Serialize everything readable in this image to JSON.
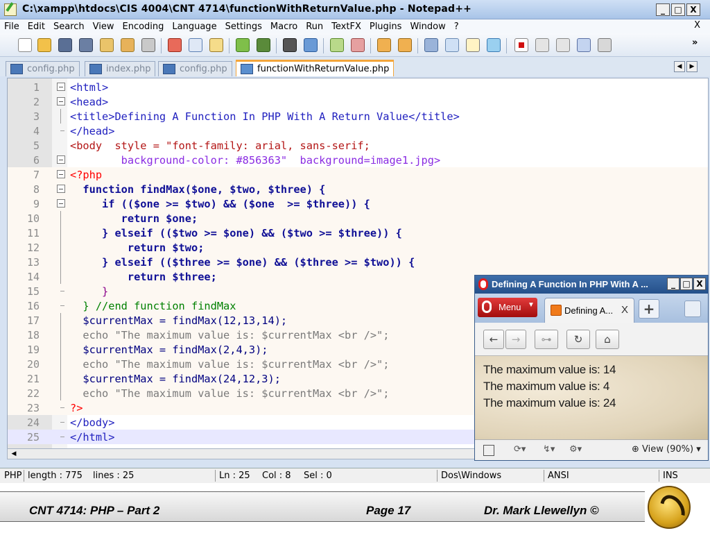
{
  "window": {
    "title": "C:\\xampp\\htdocs\\CIS 4004\\CNT 4714\\functionWithReturnValue.php - Notepad++",
    "minimize": "_",
    "maximize": "□",
    "close": "X"
  },
  "menu": {
    "items": [
      "File",
      "Edit",
      "Search",
      "View",
      "Encoding",
      "Language",
      "Settings",
      "Macro",
      "Run",
      "TextFX",
      "Plugins",
      "Window",
      "?"
    ],
    "close": "X",
    "overflow": "»"
  },
  "tabs": [
    {
      "label": "config.php"
    },
    {
      "label": "index.php"
    },
    {
      "label": "config.php"
    },
    {
      "label": "functionWithReturnValue.php",
      "active": true
    }
  ],
  "tab_scroll": {
    "left": "◀",
    "right": "▶"
  },
  "editor": {
    "line_numbers": [
      "1",
      "2",
      "3",
      "4",
      "5",
      "6",
      "7",
      "8",
      "9",
      "10",
      "11",
      "12",
      "13",
      "14",
      "15",
      "16",
      "17",
      "18",
      "19",
      "20",
      "21",
      "22",
      "23",
      "24",
      "25"
    ],
    "lines": [
      "<html>",
      "<head>",
      "<title>Defining A Function In PHP With A Return Value</title>",
      "</head>",
      "<body  style = \"font-family: arial, sans-serif;",
      "        background-color: #856363\"  background=image1.jpg>",
      "<?php",
      "  function findMax($one, $two, $three) {",
      "     if (($one >= $two) && ($one  >= $three)) {",
      "        return $one;",
      "     } elseif (($two >= $one) && ($two >= $three)) {",
      "         return $two;",
      "     } elseif (($three >= $one) && ($three >= $two)) {",
      "         return $three;",
      "     }",
      "  } //end function findMax",
      "  $currentMax = findMax(12,13,14);",
      "  echo \"The maximum value is: $currentMax <br />\";",
      "  $currentMax = findMax(2,4,3);",
      "  echo \"The maximum value is: $currentMax <br />\";",
      "  $currentMax = findMax(24,12,3);",
      "  echo \"The maximum value is: $currentMax <br />\";",
      "?>",
      "</body>",
      "</html>"
    ],
    "current_line": 25
  },
  "statusbar": {
    "type": "PHP",
    "length": "length : 775",
    "lines": "lines : 25",
    "ln": "Ln : 25",
    "col": "Col : 8",
    "sel": "Sel : 0",
    "eol": "Dos\\Windows",
    "encoding": "ANSI",
    "mode": "INS"
  },
  "browser": {
    "title": "Defining A Function In PHP With A ...",
    "menu_label": "Menu",
    "tab_label": "Defining A...",
    "tab_close": "X",
    "new_tab": "+",
    "nav": {
      "back": "←",
      "forward": "→",
      "key": "⊶",
      "reload": "↻",
      "home": "⌂"
    },
    "output": [
      "The maximum value is: 14",
      "The maximum value is: 4",
      "The maximum value is: 24"
    ],
    "zoom_label": "View (90%)"
  },
  "footer": {
    "left": "CNT 4714:  PHP – Part 2",
    "center": "Page 17",
    "right": "Dr. Mark Llewellyn ©"
  },
  "colors": {
    "tag": "#1f1fbf",
    "keyword": "#0f0f96",
    "string": "#7a7a7a",
    "number": "#f08a00",
    "comment": "#008000",
    "php_delim": "#ff0000",
    "active_tab": "#f3a53a"
  }
}
